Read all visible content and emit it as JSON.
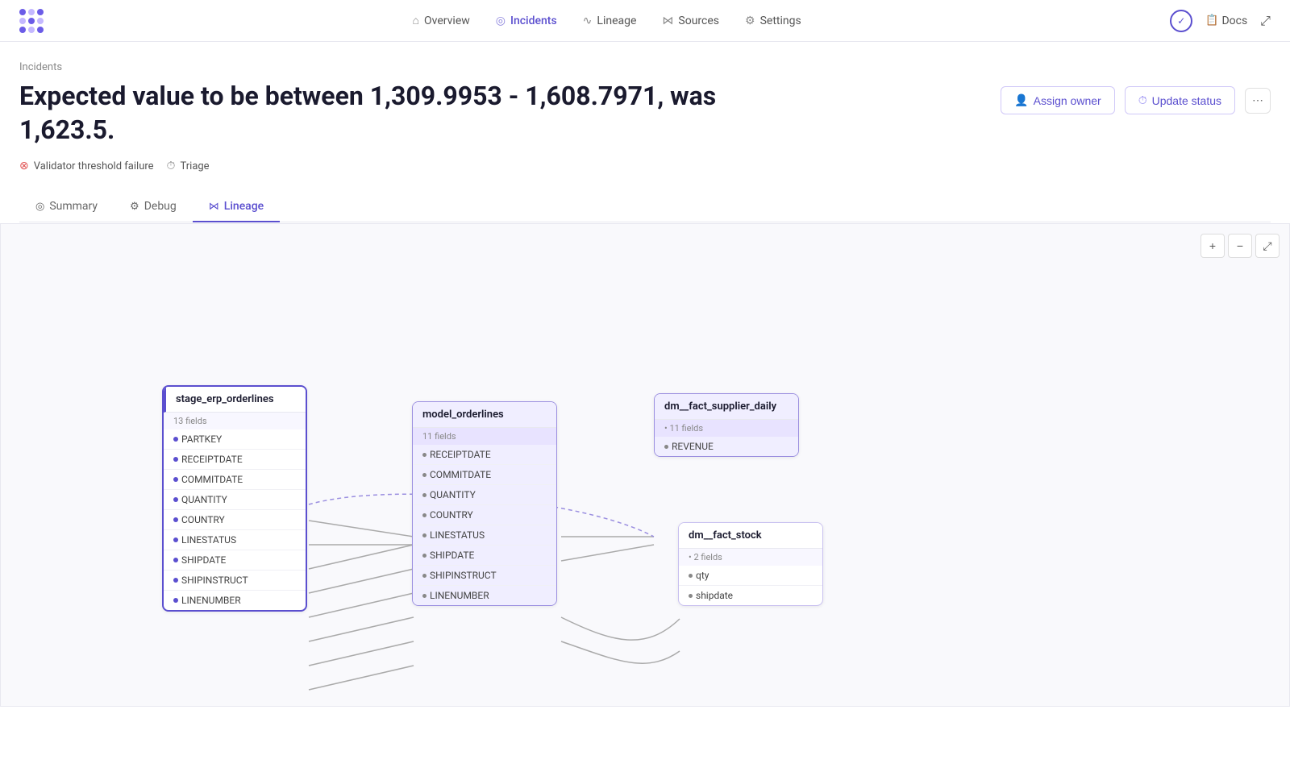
{
  "logo": {
    "alt": "Anomalo"
  },
  "nav": {
    "links": [
      {
        "id": "overview",
        "label": "Overview",
        "icon": "⌂",
        "active": false
      },
      {
        "id": "incidents",
        "label": "Incidents",
        "icon": "◎",
        "active": true
      },
      {
        "id": "lineage",
        "label": "Lineage",
        "icon": "∿",
        "active": false
      },
      {
        "id": "sources",
        "label": "Sources",
        "icon": "⋈",
        "active": false
      },
      {
        "id": "settings",
        "label": "Settings",
        "icon": "⚙",
        "active": false
      }
    ],
    "right": {
      "status_icon": "✓",
      "docs_label": "Docs",
      "expand_icon": "⤢"
    }
  },
  "breadcrumb": "Incidents",
  "incident": {
    "title": "Expected value to be between 1,309.9953 - 1,608.7971, was 1,623.5.",
    "tags": [
      {
        "id": "validator",
        "icon": "⊗",
        "label": "Validator threshold failure",
        "type": "error"
      },
      {
        "id": "triage",
        "icon": "⏱",
        "label": "Triage",
        "type": "clock"
      }
    ],
    "actions": {
      "assign_owner": "Assign owner",
      "assign_icon": "👤",
      "update_status": "Update status",
      "update_icon": "⏱",
      "more_icon": "⋯"
    }
  },
  "tabs": [
    {
      "id": "summary",
      "label": "Summary",
      "icon": "◎",
      "active": false
    },
    {
      "id": "debug",
      "label": "Debug",
      "icon": "⚙",
      "active": false
    },
    {
      "id": "lineage",
      "label": "Lineage",
      "icon": "⋈",
      "active": true
    }
  ],
  "lineage": {
    "canvas_controls": {
      "zoom_in": "+",
      "zoom_out": "−",
      "expand": "⤢"
    },
    "nodes": [
      {
        "id": "stage_erp_orderlines",
        "title": "stage_erp_orderlines",
        "fields_count": "13 fields",
        "fields": [
          "PARTKEY",
          "RECEIPTDATE",
          "COMMITDATE",
          "QUANTITY",
          "COUNTRY",
          "LINESTATUS",
          "SHIPDATE",
          "SHIPINSTRUCT",
          "LINENUMBER"
        ]
      },
      {
        "id": "model_orderlines",
        "title": "model_orderlines",
        "fields_count": "11 fields",
        "fields": [
          "RECEIPTDATE",
          "COMMITDATE",
          "QUANTITY",
          "COUNTRY",
          "LINESTATUS",
          "SHIPDATE",
          "SHIPINSTRUCT",
          "LINENUMBER"
        ]
      },
      {
        "id": "dm__fact_supplier_daily",
        "title": "dm__fact_supplier_daily",
        "fields_count": "11 fields",
        "fields": [
          "REVENUE"
        ]
      },
      {
        "id": "dm__fact_stock",
        "title": "dm__fact_stock",
        "fields_count": "2 fields",
        "fields": [
          "qty",
          "shipdate"
        ]
      }
    ]
  }
}
